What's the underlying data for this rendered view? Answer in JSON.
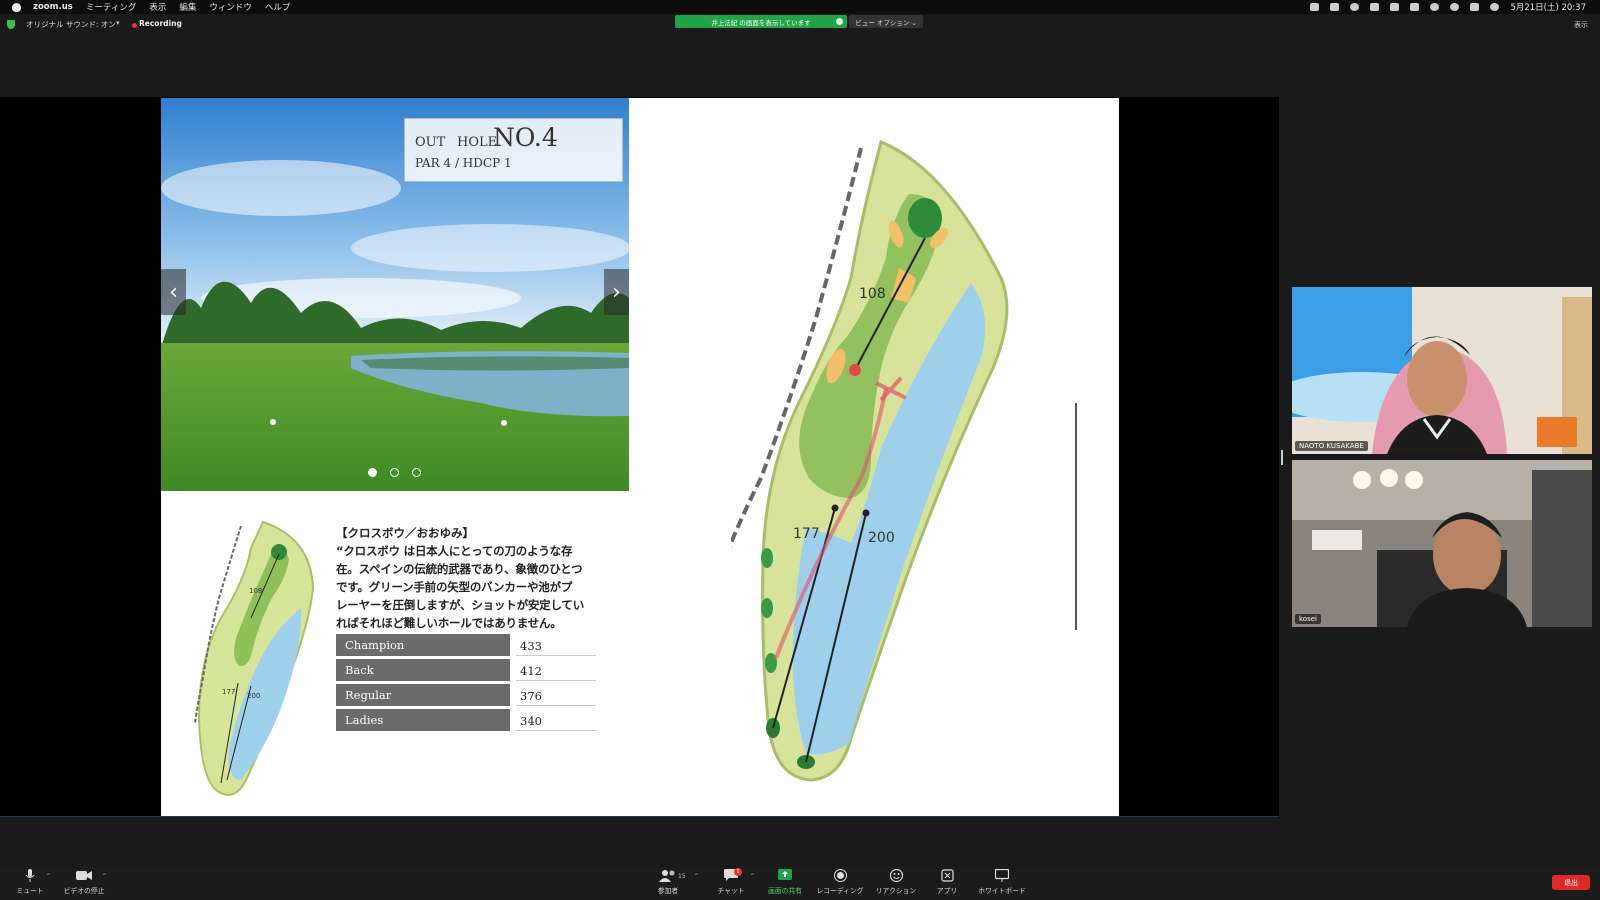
{
  "menubar": {
    "app": "zoom.us",
    "items": [
      "ミーティング",
      "表示",
      "編集",
      "ウィンドウ",
      "ヘルプ"
    ],
    "clock": "5月21日(土)  20:37"
  },
  "topbar": {
    "audio_label": "オリジナル サウンド: オン",
    "recording_label": "Recording",
    "share_banner": "井上法紀 の画面を表示しています",
    "view_options": "ビュー オプション ⌄",
    "display_label": "表示"
  },
  "slide": {
    "title_out": "OUT",
    "title_hole": "HOLE",
    "title_no": "NO.4",
    "title_par": "PAR 4 / HDCP 1",
    "desc_title": "【クロスボウ／おおゆみ】",
    "desc_lines": [
      "“クロスボウ は日本人にとっての刀のような存",
      "在。スペインの伝統的武器であり、象徴のひとつ",
      "です。グリーン手前の矢型のバンカーや池がプ",
      "レーヤーを圧倒しますが、ショットが安定してい",
      "ればそれほど難しいホールではありません。"
    ],
    "yardage": [
      {
        "tee": "Champion",
        "yards": "433"
      },
      {
        "tee": "Back",
        "yards": "412"
      },
      {
        "tee": "Regular",
        "yards": "376"
      },
      {
        "tee": "Ladies",
        "yards": "340"
      }
    ],
    "map_labels": {
      "top": "108",
      "left": "177",
      "right": "200"
    },
    "thumb_labels": {
      "top": "108",
      "left": "177",
      "right": "200"
    }
  },
  "participants": [
    {
      "name": "NAOTO KUSAKABE"
    },
    {
      "name": "kosei"
    }
  ],
  "toolbar": {
    "mute": "ミュート",
    "video": "ビデオの停止",
    "participants": "参加者",
    "participants_count": "15",
    "chat": "チャット",
    "chat_badge": "1",
    "share": "画面の共有",
    "record": "レコーディング",
    "reactions": "リアクション",
    "apps": "アプリ",
    "whiteboard": "ホワイトボード",
    "leave": "退出"
  }
}
